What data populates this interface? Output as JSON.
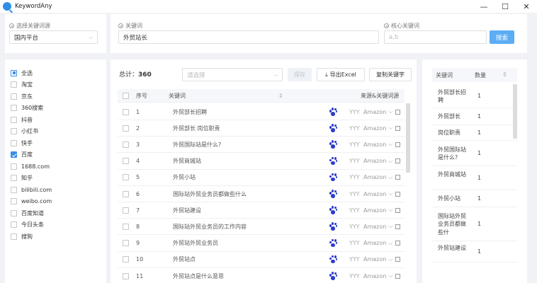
{
  "window": {
    "title": "KeywordAny",
    "min": "—",
    "max": "☐",
    "close": "✕"
  },
  "search": {
    "platform_label": "选择关键词源",
    "platform_value": "国内平台",
    "keyword_label": "关键词",
    "keyword_value": "外贸站长",
    "core_label": "核心关键词",
    "core_placeholder": "a,b",
    "search_button": "搜索"
  },
  "sources": [
    {
      "label": "全选",
      "state": "indeterminate"
    },
    {
      "label": "淘宝",
      "state": "unchecked"
    },
    {
      "label": "京东",
      "state": "unchecked"
    },
    {
      "label": "360搜索",
      "state": "unchecked"
    },
    {
      "label": "抖音",
      "state": "unchecked"
    },
    {
      "label": "小红书",
      "state": "unchecked"
    },
    {
      "label": "快手",
      "state": "unchecked"
    },
    {
      "label": "百度",
      "state": "checked"
    },
    {
      "label": "1688.com",
      "state": "unchecked"
    },
    {
      "label": "知乎",
      "state": "unchecked"
    },
    {
      "label": "bilibili.com",
      "state": "unchecked"
    },
    {
      "label": "weibo.com",
      "state": "unchecked"
    },
    {
      "label": "百度知道",
      "state": "unchecked"
    },
    {
      "label": "今日头条",
      "state": "unchecked"
    },
    {
      "label": "搜狗",
      "state": "unchecked"
    }
  ],
  "toolbar": {
    "total_label": "总计：",
    "total_value": "360",
    "select_placeholder": "请选择",
    "save_label": "保存",
    "export_label": "导出Excel",
    "copy_label": "复制关键字"
  },
  "table": {
    "columns": {
      "index": "序号",
      "keyword": "关键词",
      "source": "来源&关键词源"
    },
    "rows": [
      {
        "index": "1",
        "keyword": "外贸部长招聘",
        "yyy": "YYY",
        "amazon": "Amazon"
      },
      {
        "index": "2",
        "keyword": "外贸部长 岗位职责",
        "yyy": "YYY",
        "amazon": "Amazon"
      },
      {
        "index": "3",
        "keyword": "外贸国际站是什么?",
        "yyy": "YYY",
        "amazon": "Amazon"
      },
      {
        "index": "4",
        "keyword": "外贸商城站",
        "yyy": "YYY",
        "amazon": "Amazon"
      },
      {
        "index": "5",
        "keyword": "外贸小站",
        "yyy": "YYY",
        "amazon": "Amazon"
      },
      {
        "index": "6",
        "keyword": "国际站外贸业务员都做些什么",
        "yyy": "YYY",
        "amazon": "Amazon"
      },
      {
        "index": "7",
        "keyword": "外贸站建设",
        "yyy": "YYY",
        "amazon": "Amazon"
      },
      {
        "index": "8",
        "keyword": "国际站外贸业务员的工作内容",
        "yyy": "YYY",
        "amazon": "Amazon"
      },
      {
        "index": "9",
        "keyword": "外贸站外贸业务员",
        "yyy": "YYY",
        "amazon": "Amazon"
      },
      {
        "index": "10",
        "keyword": "外贸站点",
        "yyy": "YYY",
        "amazon": "Amazon"
      },
      {
        "index": "11",
        "keyword": "外贸站点是什么意思",
        "yyy": "YYY",
        "amazon": "Amazon"
      }
    ]
  },
  "right_panel": {
    "columns": {
      "keyword": "关键词",
      "count": "数量"
    },
    "rows": [
      {
        "keyword": "外贸部长招聘",
        "count": "1"
      },
      {
        "keyword": "外贸部长",
        "count": "1"
      },
      {
        "keyword": "岗位职责",
        "count": "1"
      },
      {
        "keyword": "外贸国际站是什么?",
        "count": "1"
      },
      {
        "keyword": "外贸商城站",
        "count": "1"
      },
      {
        "keyword": "外贸小站",
        "count": "1"
      },
      {
        "keyword": "国际站外贸业务员都做些什",
        "count": "1"
      },
      {
        "keyword": "外贸站建设",
        "count": "1"
      }
    ]
  }
}
